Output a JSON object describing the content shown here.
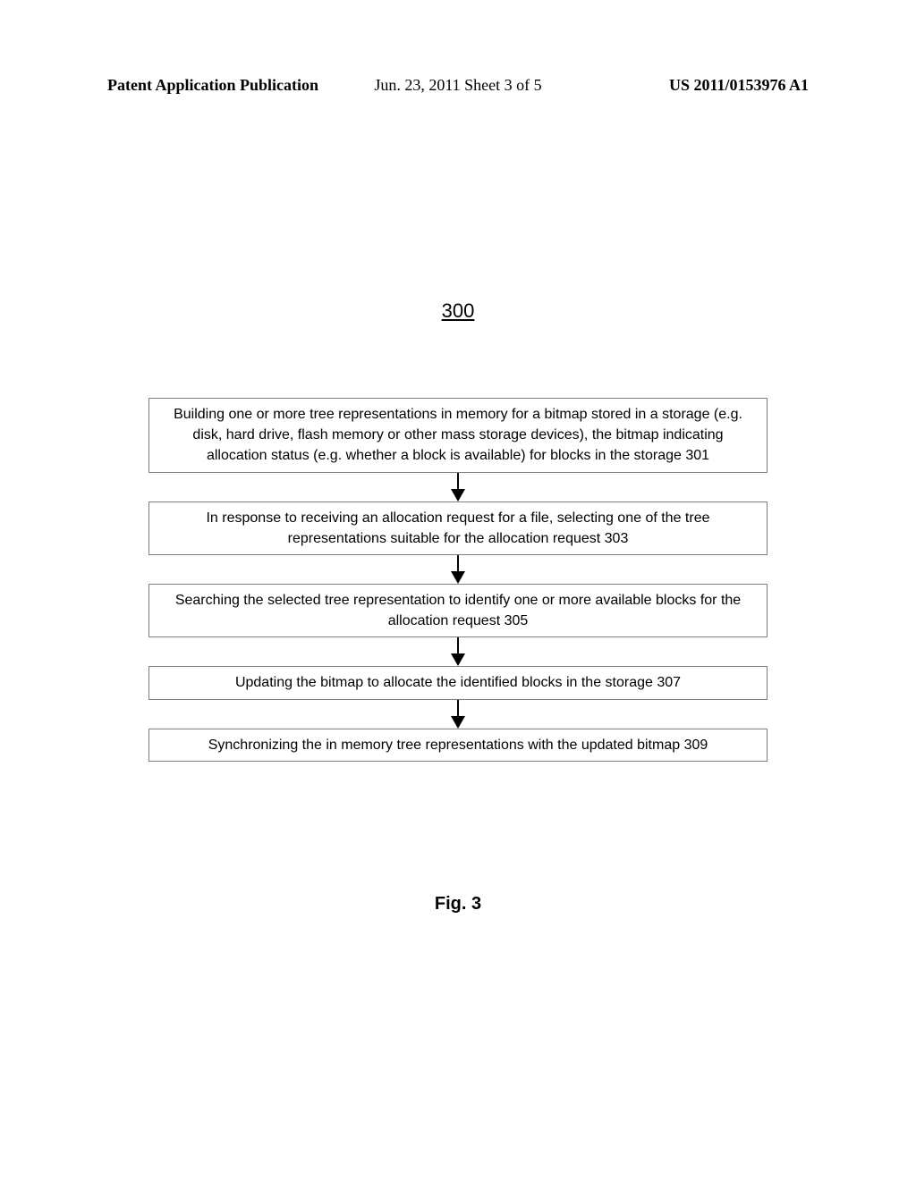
{
  "header": {
    "left": "Patent Application Publication",
    "mid": "Jun. 23, 2011  Sheet 3 of 5",
    "right": "US 2011/0153976 A1"
  },
  "reference_number": "300",
  "figure_caption": "Fig. 3",
  "chart_data": {
    "type": "flowchart",
    "title": "300",
    "steps": [
      {
        "id": "301",
        "text": "Building one or more tree representations in memory for a bitmap stored in a storage (e.g. disk, hard drive, flash memory or other mass storage devices), the bitmap indicating allocation status (e.g. whether a block is available) for blocks in the storage 301"
      },
      {
        "id": "303",
        "text": "In response to receiving an allocation request for a file, selecting one of the tree representations suitable for the allocation request   303"
      },
      {
        "id": "305",
        "text": "Searching the selected tree representation to identify one or more available blocks for the allocation request   305"
      },
      {
        "id": "307",
        "text": "Updating the bitmap to allocate the identified blocks in the storage 307"
      },
      {
        "id": "309",
        "text": "Synchronizing the in memory tree representations with the updated bitmap 309"
      }
    ],
    "edges": [
      {
        "from": "301",
        "to": "303"
      },
      {
        "from": "303",
        "to": "305"
      },
      {
        "from": "305",
        "to": "307"
      },
      {
        "from": "307",
        "to": "309"
      }
    ]
  }
}
